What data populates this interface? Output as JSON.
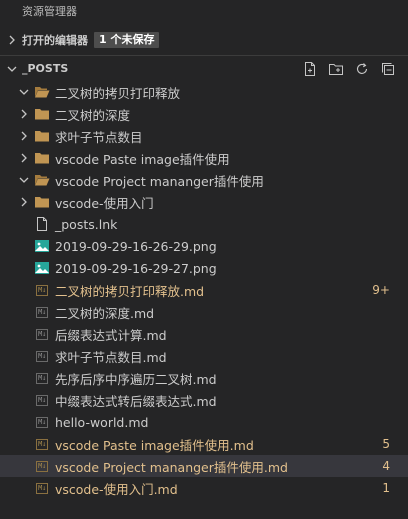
{
  "panel": {
    "title": "资源管理器"
  },
  "open_editors": {
    "label": "打开的编辑器",
    "badge": "1 个未保存"
  },
  "posts": {
    "label": "_POSTS",
    "actions": [
      {
        "name": "new-file-icon"
      },
      {
        "name": "new-folder-icon"
      },
      {
        "name": "refresh-icon"
      },
      {
        "name": "collapse-all-icon"
      }
    ]
  },
  "tree": [
    {
      "type": "folder",
      "label": "二叉树的拷贝打印释放",
      "expanded": true,
      "modified": false,
      "selected": false,
      "count": ""
    },
    {
      "type": "folder",
      "label": "二叉树的深度",
      "expanded": false,
      "modified": false,
      "selected": false,
      "count": ""
    },
    {
      "type": "folder",
      "label": "求叶子节点数目",
      "expanded": false,
      "modified": false,
      "selected": false,
      "count": ""
    },
    {
      "type": "folder",
      "label": "vscode Paste image插件使用",
      "expanded": false,
      "modified": false,
      "selected": false,
      "count": ""
    },
    {
      "type": "folder",
      "label": "vscode Project mananger插件使用",
      "expanded": true,
      "modified": false,
      "selected": false,
      "count": ""
    },
    {
      "type": "folder",
      "label": "vscode-使用入门",
      "expanded": false,
      "modified": false,
      "selected": false,
      "count": ""
    },
    {
      "type": "file",
      "icon": "file",
      "label": "_posts.lnk",
      "modified": false,
      "selected": false,
      "count": ""
    },
    {
      "type": "file",
      "icon": "image",
      "label": "2019-09-29-16-26-29.png",
      "modified": false,
      "selected": false,
      "count": ""
    },
    {
      "type": "file",
      "icon": "image",
      "label": "2019-09-29-16-29-27.png",
      "modified": false,
      "selected": false,
      "count": ""
    },
    {
      "type": "file",
      "icon": "md",
      "label": "二叉树的拷贝打印释放.md",
      "modified": true,
      "selected": false,
      "count": "9+"
    },
    {
      "type": "file",
      "icon": "md",
      "label": "二叉树的深度.md",
      "modified": false,
      "selected": false,
      "count": ""
    },
    {
      "type": "file",
      "icon": "md",
      "label": "后缀表达式计算.md",
      "modified": false,
      "selected": false,
      "count": ""
    },
    {
      "type": "file",
      "icon": "md",
      "label": "求叶子节点数目.md",
      "modified": false,
      "selected": false,
      "count": ""
    },
    {
      "type": "file",
      "icon": "md",
      "label": "先序后序中序遍历二叉树.md",
      "modified": false,
      "selected": false,
      "count": ""
    },
    {
      "type": "file",
      "icon": "md",
      "label": "中缀表达式转后缀表达式.md",
      "modified": false,
      "selected": false,
      "count": ""
    },
    {
      "type": "file",
      "icon": "md",
      "label": "hello-world.md",
      "modified": false,
      "selected": false,
      "count": ""
    },
    {
      "type": "file",
      "icon": "md",
      "label": "vscode Paste image插件使用.md",
      "modified": true,
      "selected": false,
      "count": "5"
    },
    {
      "type": "file",
      "icon": "md",
      "label": "vscode Project mananger插件使用.md",
      "modified": true,
      "selected": true,
      "count": "4"
    },
    {
      "type": "file",
      "icon": "md",
      "label": "vscode-使用入门.md",
      "modified": true,
      "selected": false,
      "count": "1"
    }
  ],
  "md_tag": "M↓",
  "colors": {
    "background": "#252526",
    "modified": "#e2c08d",
    "folder": "#c09553",
    "image": "#26a69a",
    "selection": "#37373d"
  }
}
